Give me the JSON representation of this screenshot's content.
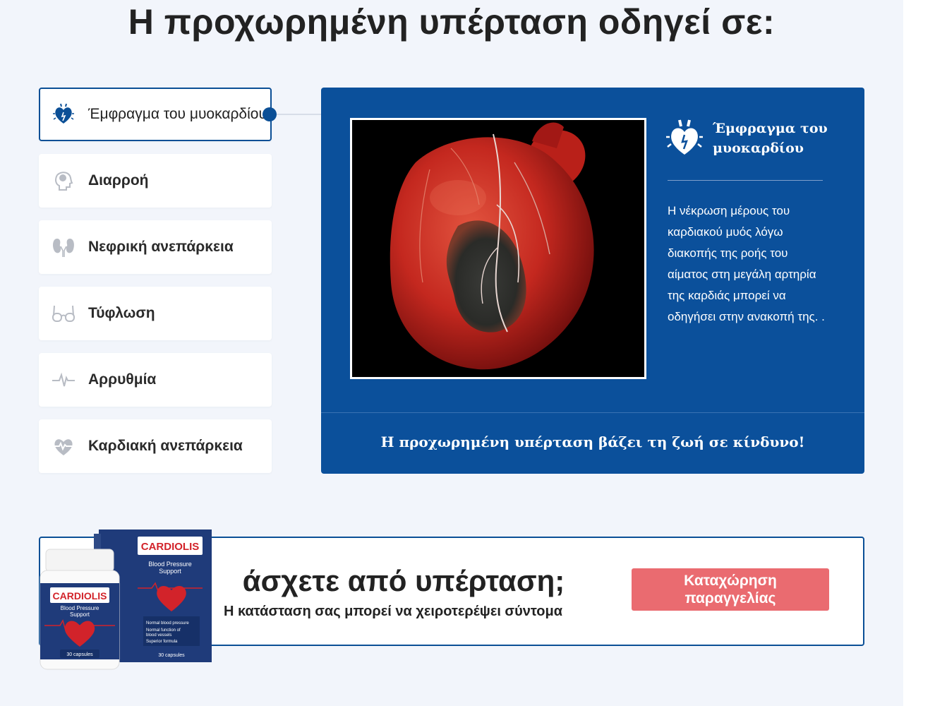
{
  "heading": "Η προχωρημένη υπέρταση οδηγεί σε:",
  "tabs": [
    {
      "label": "Έμφραγμα του μυοκαρδίου",
      "icon": "heart-attack-icon",
      "active": true
    },
    {
      "label": "Διαρροή",
      "icon": "brain-head-icon",
      "active": false
    },
    {
      "label": "Νεφρική ανεπάρκεια",
      "icon": "kidneys-icon",
      "active": false
    },
    {
      "label": "Τύφλωση",
      "icon": "glasses-icon",
      "active": false
    },
    {
      "label": "Αρρυθμία",
      "icon": "pulse-line-icon",
      "active": false
    },
    {
      "label": "Καρδιακή ανεπάρκεια",
      "icon": "heart-pulse-icon",
      "active": false
    }
  ],
  "panel": {
    "title": "Έμφραγμα του μυοκαρδίου",
    "text": "Η νέκρωση μέρους του καρδιακού μυός λόγω διακοπής της ροής του αίματος στη μεγάλη αρτηρία της καρδιάς μπορεί να οδηγήσει στην ανακοπή της. .",
    "footer": "Η προχωρημένη υπέρταση βάζει τη ζωή σε κίνδυνο!"
  },
  "banner": {
    "heading": "άσχετε από υπέρταση;",
    "subheading": "Η κατάσταση σας μπορεί να χειροτερέψει σύντομα",
    "button_line1": "Καταχώρηση",
    "button_line2": "παραγγελίας"
  },
  "product": {
    "brand": "CARDIOLIS",
    "tagline_line1": "Blood Pressure",
    "tagline_line2": "Support",
    "capsules": "30 capsules",
    "bullets": [
      "Normal blood pressure",
      "Normal function of",
      "blood vessels",
      "Superior formula"
    ]
  },
  "colors": {
    "primary": "#0b509b",
    "button": "#ea6b70",
    "background": "#f2f5fb",
    "brand_red": "#d2232a"
  }
}
